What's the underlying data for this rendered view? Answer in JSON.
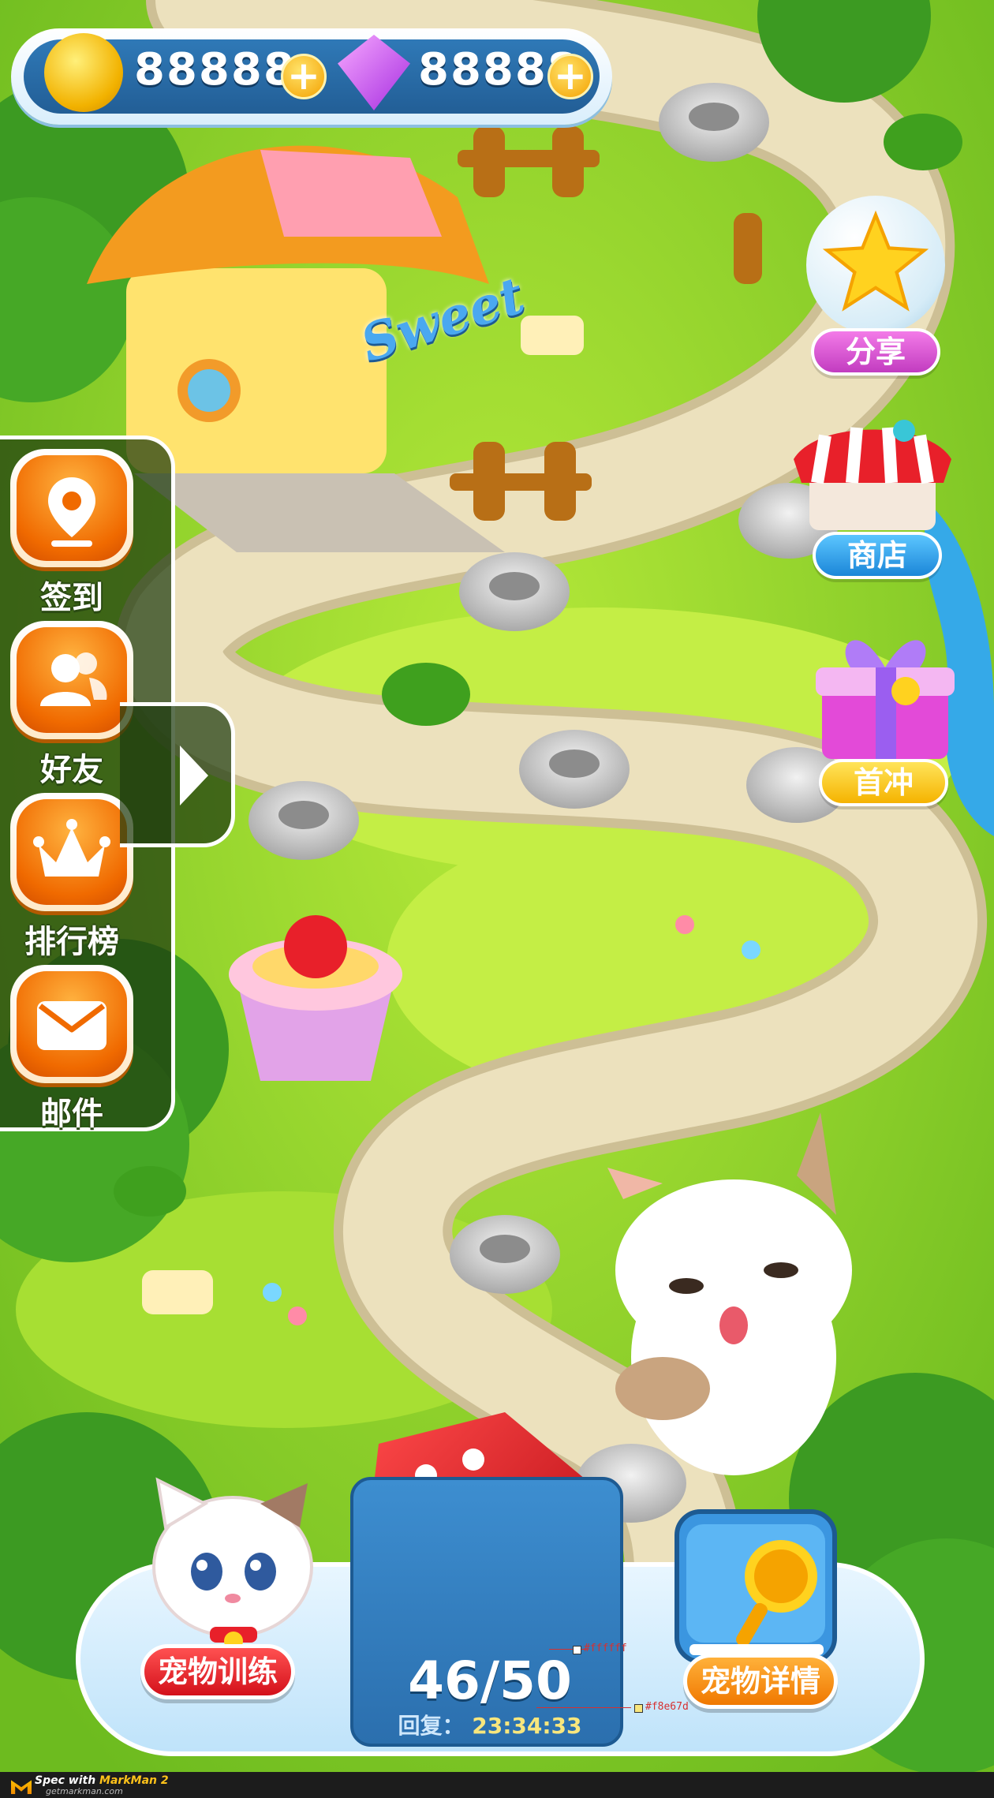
{
  "currency": {
    "coins": "88888",
    "gems": "88888",
    "plus": "+"
  },
  "left_menu": {
    "items": [
      {
        "label": "签到",
        "icon": "location-pin-icon"
      },
      {
        "label": "好友",
        "icon": "friends-icon"
      },
      {
        "label": "排行榜",
        "icon": "crown-icon"
      },
      {
        "label": "邮件",
        "icon": "mail-icon"
      }
    ],
    "toggle_icon": "chevron-right-icon"
  },
  "right_menu": {
    "share": "分享",
    "shop": "商店",
    "first_recharge": "首冲"
  },
  "house_sign": "Sweet",
  "bottom": {
    "pet_training": "宠物训练",
    "pet_details": "宠物详情",
    "dice_count": "46/50",
    "recover_label": "回复：",
    "recover_time": "23:34:33"
  },
  "annotations": {
    "white": "#ffffff",
    "yellow": "#f8e67d"
  },
  "footer": {
    "spec_with": "Spec with",
    "app": "MarkMan 2",
    "url": "getmarkman.com"
  },
  "colors": {
    "grass": "#8fd13a",
    "path": "#e9ddb8",
    "orange_button": "#f06a00",
    "blue_panel": "#2f79b7",
    "red_pill": "#e8202a",
    "gold_pill": "#f5a300"
  }
}
